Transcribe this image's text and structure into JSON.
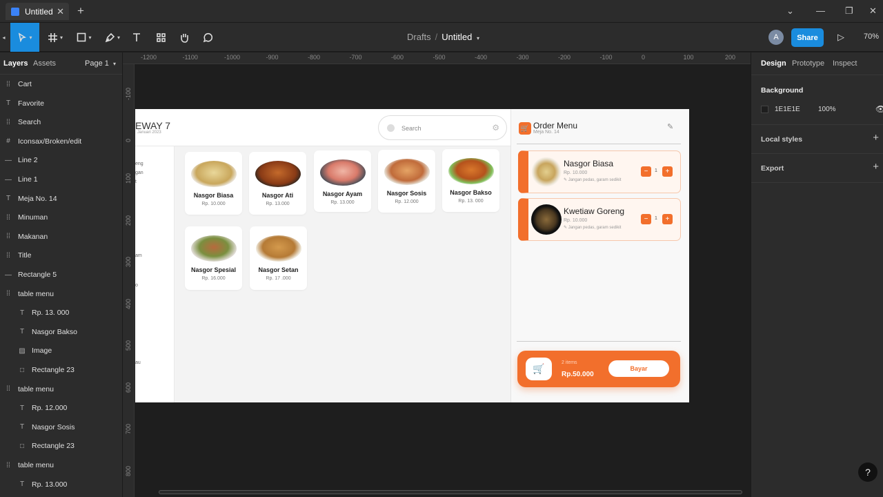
{
  "app": {
    "tab_title": "Untitled",
    "crumb_drafts": "Drafts",
    "crumb_sep": "/",
    "crumb_title": "Untitled",
    "avatar_letter": "A",
    "share_label": "Share",
    "zoom": "70%"
  },
  "layers_panel": {
    "tab_layers": "Layers",
    "tab_assets": "Assets",
    "page": "Page 1",
    "items": [
      {
        "icon": "frame-icon",
        "label": "Cart"
      },
      {
        "icon": "text-icon",
        "label": "Favorite"
      },
      {
        "icon": "frame-icon",
        "label": "Search"
      },
      {
        "icon": "grid-icon",
        "label": "Iconsax/Broken/edit"
      },
      {
        "icon": "line-icon",
        "label": "Line 2"
      },
      {
        "icon": "line-icon",
        "label": "Line 1"
      },
      {
        "icon": "text-icon",
        "label": "Meja No. 14"
      },
      {
        "icon": "frame-icon",
        "label": "Minuman"
      },
      {
        "icon": "frame-icon",
        "label": "Makanan"
      },
      {
        "icon": "frame-icon",
        "label": "Title"
      },
      {
        "icon": "line-icon",
        "label": "Rectangle 5"
      },
      {
        "icon": "frame-icon",
        "label": "table menu"
      },
      {
        "icon": "text-icon",
        "label": "Rp. 13. 000"
      },
      {
        "icon": "text-icon",
        "label": "Nasgor Bakso"
      },
      {
        "icon": "image-icon",
        "label": "Image"
      },
      {
        "icon": "rect-icon",
        "label": "Rectangle 23"
      },
      {
        "icon": "frame-icon",
        "label": "table menu"
      },
      {
        "icon": "text-icon",
        "label": "Rp. 12.000"
      },
      {
        "icon": "text-icon",
        "label": "Nasgor Sosis"
      },
      {
        "icon": "rect-icon",
        "label": "Rectangle 23"
      },
      {
        "icon": "frame-icon",
        "label": "table menu"
      },
      {
        "icon": "text-icon",
        "label": "Rp. 13.000"
      }
    ]
  },
  "rulers": {
    "h": [
      "-1200",
      "-1100",
      "-1000",
      "-900",
      "-800",
      "-700",
      "-600",
      "-500",
      "-400",
      "-300",
      "-200",
      "-100",
      "0",
      "100",
      "200"
    ],
    "v": [
      "-100",
      "0",
      "100",
      "200",
      "300",
      "400",
      "500",
      "600",
      "700",
      "800"
    ]
  },
  "design_frame": {
    "brand": "EWAY 7",
    "brand_date": "Januari 2023",
    "search_placeholder": "Search",
    "sidenav_fragments": [
      "eng",
      "gan",
      "t",
      "am",
      "o",
      "au"
    ],
    "menu": [
      {
        "name": "Nasgor Biasa",
        "price": "Rp. 10.000"
      },
      {
        "name": "Nasgor Ati",
        "price": "Rp. 13.000"
      },
      {
        "name": "Nasgor Ayam",
        "price": "Rp. 13.000"
      },
      {
        "name": "Nasgor Sosis",
        "price": "Rp. 12.000"
      },
      {
        "name": "Nasgor Bakso",
        "price": "Rp. 13. 000"
      },
      {
        "name": "Nasgor Spesial",
        "price": "Rp. 16.000"
      },
      {
        "name": "Nasgor Setan",
        "price": "Rp. 17 .000"
      }
    ],
    "order": {
      "title": "Order Menu",
      "table": "Meja No. 14",
      "items": [
        {
          "name": "Nasgor Biasa",
          "price": "Rp. 10.000",
          "note": "Jangan pedas, garam sedikit",
          "qty": "1"
        },
        {
          "name": "Kwetiaw Goreng",
          "price": "Rp. 10.000",
          "note": "Jangan pedas, garam sedikit",
          "qty": "1"
        }
      ],
      "items_count": "2 items",
      "total": "Rp.50.000",
      "pay_label": "Bayar"
    }
  },
  "design_panel": {
    "tab_design": "Design",
    "tab_prototype": "Prototype",
    "tab_inspect": "Inspect",
    "background_label": "Background",
    "background_hex": "1E1E1E",
    "background_opacity": "100%",
    "local_styles": "Local styles",
    "export": "Export"
  },
  "help": "?",
  "colors": {
    "accent": "#1a8cde",
    "brand_orange": "#f26f2c"
  }
}
